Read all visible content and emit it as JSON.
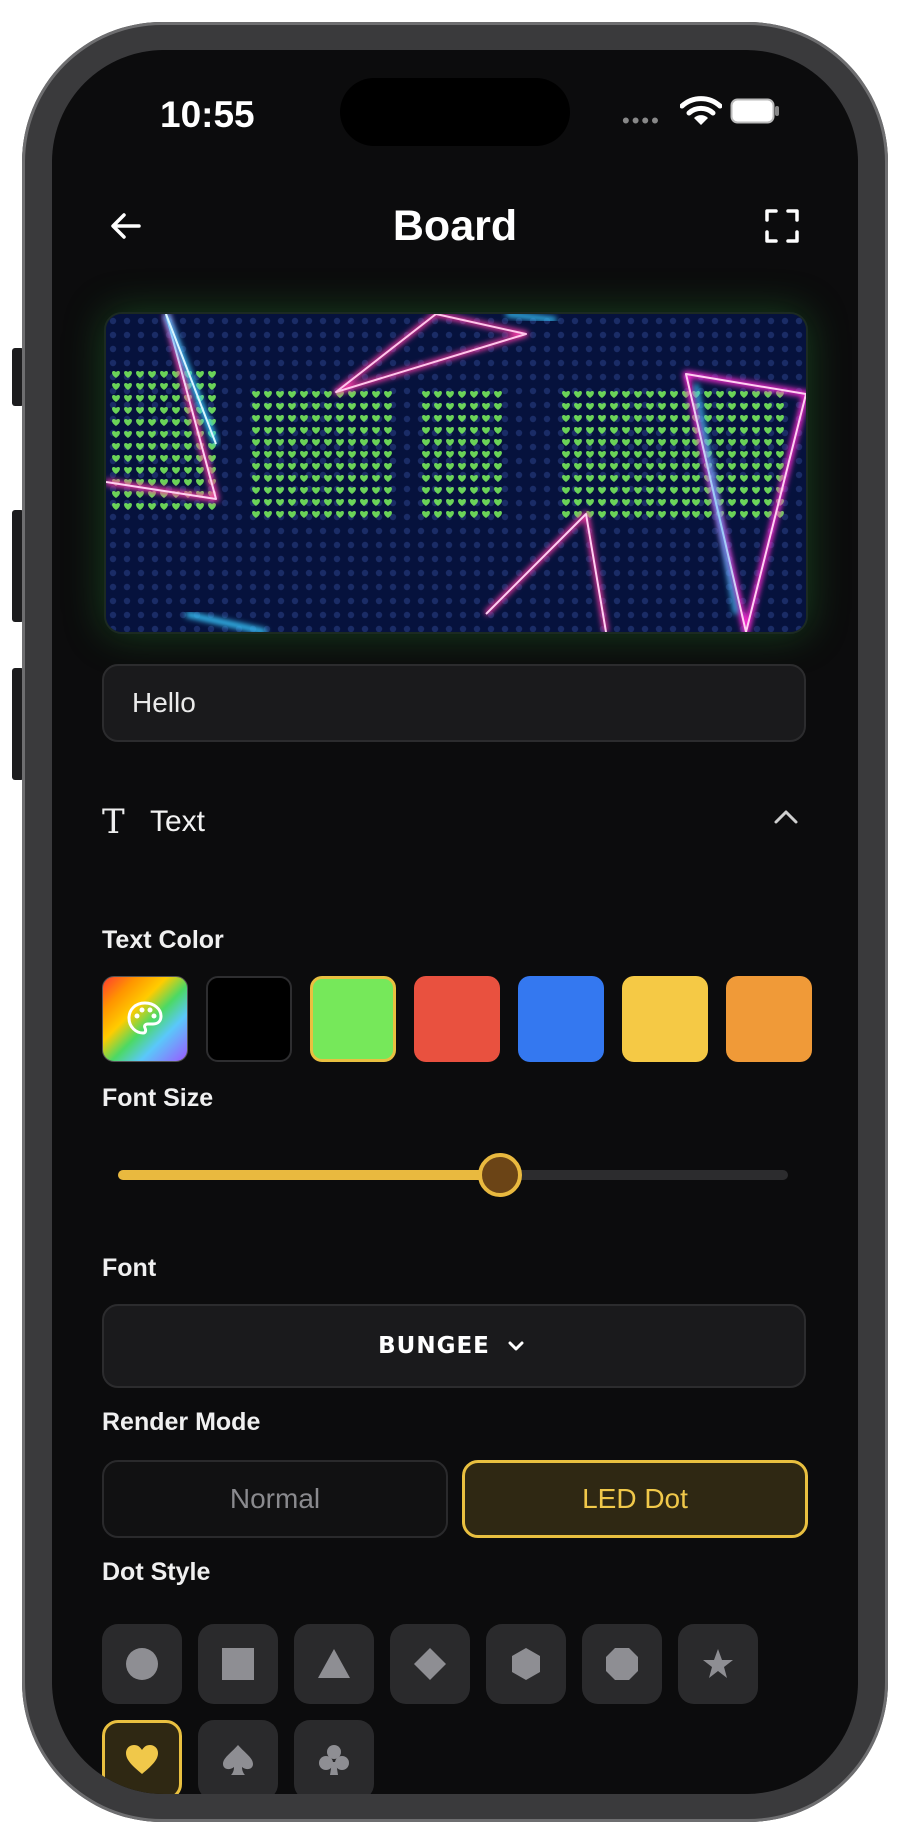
{
  "status": {
    "time": "10:55"
  },
  "nav": {
    "title": "Board",
    "back_icon": "arrow-left-icon",
    "fullscreen_icon": "fullscreen-icon"
  },
  "input": {
    "value": "Hello"
  },
  "text_section": {
    "label": "Text",
    "icon": "text-icon",
    "collapse_icon": "chevron-up-icon"
  },
  "labels": {
    "text_color": "Text Color",
    "font_size": "Font Size",
    "font": "Font",
    "render_mode": "Render Mode",
    "dot_style": "Dot Style"
  },
  "colors": [
    "rainbow-palette",
    "#000000",
    "#76e85a",
    "#e9513f",
    "#3478f0",
    "#f5c945",
    "#f09a38"
  ],
  "selected_color": "#76e85a",
  "font_size": {
    "value_fraction": 0.57
  },
  "font": {
    "value": "BUNGEE"
  },
  "render_modes": {
    "normal": "Normal",
    "led": "LED Dot",
    "selected": "LED Dot"
  },
  "dot_styles": [
    "circle",
    "square",
    "triangle",
    "diamond",
    "hexagon",
    "octagon",
    "star",
    "heart",
    "spade",
    "club"
  ],
  "selected_dot_style": "heart",
  "theme": {
    "accent": "#e9c040",
    "background": "#0c0c0d"
  }
}
